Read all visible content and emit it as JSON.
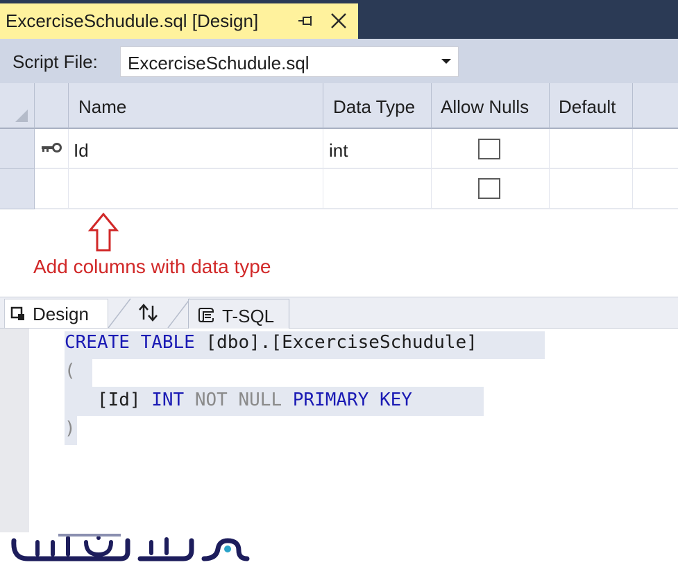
{
  "document_tab": {
    "title": "ExcerciseSchudule.sql [Design]"
  },
  "script_file": {
    "label": "Script File:",
    "value": "ExcerciseSchudule.sql"
  },
  "grid": {
    "columns": [
      "Name",
      "Data Type",
      "Allow Nulls",
      "Default"
    ],
    "rows": [
      {
        "name": "Id",
        "data_type": "int",
        "allow_nulls": false,
        "is_primary_key": true
      },
      {
        "name": "",
        "data_type": "",
        "allow_nulls": false,
        "is_primary_key": false
      }
    ]
  },
  "annotation": {
    "text": "Add columns with data type",
    "color": "#d12828"
  },
  "pane_tabs": {
    "design": "Design",
    "tsql": "T-SQL"
  },
  "sql": {
    "line1_kw": "CREATE TABLE",
    "line1_rest": "[dbo].[ExcerciseSchudule]",
    "line2": "(",
    "line3_id": "[Id]",
    "line3_type": "INT",
    "line3_null": "NOT NULL",
    "line3_pk": "PRIMARY KEY",
    "line4": ")"
  },
  "colors": {
    "title_bar": "#2b3a55",
    "active_tab": "#fff29d",
    "keyword": "#1a1ab4"
  }
}
